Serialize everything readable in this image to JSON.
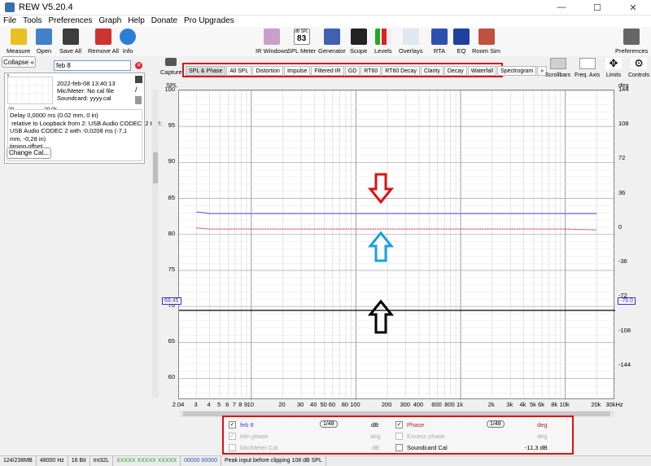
{
  "window": {
    "title": "REW V5.20.4",
    "min": "—",
    "max": "☐",
    "close": "✕"
  },
  "menu": [
    "File",
    "Tools",
    "Preferences",
    "Graph",
    "Help",
    "Donate",
    "Pro Upgrades"
  ],
  "toolbar": {
    "left": [
      "Measure",
      "Open",
      "Save All",
      "Remove All",
      "Info"
    ],
    "center": [
      "IR Windows",
      "SPL Meter",
      "Generator",
      "Scope",
      "Levels",
      "Overlays",
      "RTA",
      "EQ",
      "Room Sim"
    ],
    "spl_meter_top": "dB SPL",
    "spl_meter_value": "83",
    "right": "Preferences"
  },
  "sidebar": {
    "collapse_label": "Collapse",
    "measurement_name": "feb 8",
    "thumb_ticks": [
      "20",
      "20.0k"
    ],
    "thumb_num": "1",
    "info": [
      "2022-feb-08 13:40:13",
      "Mic/Meter: No cal file",
      "Soundcard: yyyy.cal"
    ],
    "notes": [
      "Delay 0,0000 ms (0.02 mm, 0 in)",
      " relative to Loopback from 2: USB Audio CODEC  2 to 2:",
      "USB Audio CODEC  2 with -0,0208 ms (-7,1 mm, -0,28 in)",
      "timing offset"
    ],
    "change_cal": "Change Cal..."
  },
  "capture_label": "Capture",
  "tabs": [
    "SPL & Phase",
    "All SPL",
    "Distortion",
    "Impulse",
    "Filtered IR",
    "GD",
    "RT60",
    "RT60 Decay",
    "Clarity",
    "Decay",
    "Waterfall",
    "Spectrogram",
    "»"
  ],
  "right_tools": [
    "Scrollbars",
    "Freq. Axis",
    "Limits",
    "Controls"
  ],
  "graph": {
    "y_left_unit": "SPL",
    "y_right_unit": "deg",
    "y_left_ticks": [
      "100",
      "95",
      "90",
      "85",
      "80",
      "75",
      "70",
      "65",
      "60"
    ],
    "y_right_ticks": [
      "144",
      "108",
      "72",
      "36",
      "0",
      "-36",
      "-72",
      "-108",
      "-144"
    ],
    "x_ticks": [
      "2.04",
      "3",
      "4",
      "5",
      "6",
      "7",
      "8",
      "9",
      "10",
      "20",
      "30",
      "40",
      "50",
      "60",
      "80",
      "100",
      "200",
      "300",
      "400",
      "600",
      "800",
      "1k",
      "2k",
      "3k",
      "4k",
      "5k",
      "6k",
      "8k",
      "10k",
      "20k",
      "30kHz"
    ],
    "cursor_left": "69.45",
    "cursor_right": "-76.0"
  },
  "chart_data": {
    "type": "line",
    "series": [
      {
        "name": "feb 8",
        "unit": "dB",
        "color": "#4a4ac8",
        "x": [
          3,
          4,
          10,
          100,
          1000,
          10000,
          20000
        ],
        "y": [
          83.1,
          82.9,
          82.9,
          82.9,
          82.9,
          82.9,
          82.9
        ]
      },
      {
        "name": "Phase",
        "unit": "deg",
        "color": "#b02828",
        "x": [
          3,
          4,
          10,
          100,
          1000,
          10000,
          20000
        ],
        "y": [
          0,
          -1,
          -1,
          -1,
          -1,
          -1,
          -2
        ]
      }
    ],
    "xlim": [
      2.04,
      30000
    ],
    "xscale": "log",
    "ylim_left": [
      57,
      100
    ],
    "ylim_right": [
      -180,
      144
    ],
    "cursor": {
      "y": 69.45
    }
  },
  "legend": {
    "items": [
      {
        "label": "feb 8",
        "checked": "✓",
        "smoothing": "1/48",
        "unit": "dB",
        "value": ""
      },
      {
        "label": "Phase",
        "checked": "✓",
        "smoothing": "1/48",
        "unit": "deg",
        "value": ""
      },
      {
        "label": "Min phase",
        "checked": "✓",
        "unit": "deg"
      },
      {
        "label": "Excess phase",
        "checked": "",
        "unit": "deg"
      },
      {
        "label": "Mic/Meter Cal",
        "checked": "",
        "unit": "dB"
      },
      {
        "label": "Soundcard Cal",
        "checked": "",
        "value": "-11,3 dB"
      }
    ]
  },
  "status": [
    "124/238MB",
    "48000 Hz",
    "16 Bit",
    "Int32L",
    "XXXXX XXXXX XXXXX",
    "00000 00000",
    "Peak input before clipping 108 dB SPL"
  ],
  "colors": {
    "red_box": "#e01010",
    "spl_trace": "#4a4ac8",
    "phase_trace": "#b02828",
    "blue_cursor": "#3030c0"
  }
}
